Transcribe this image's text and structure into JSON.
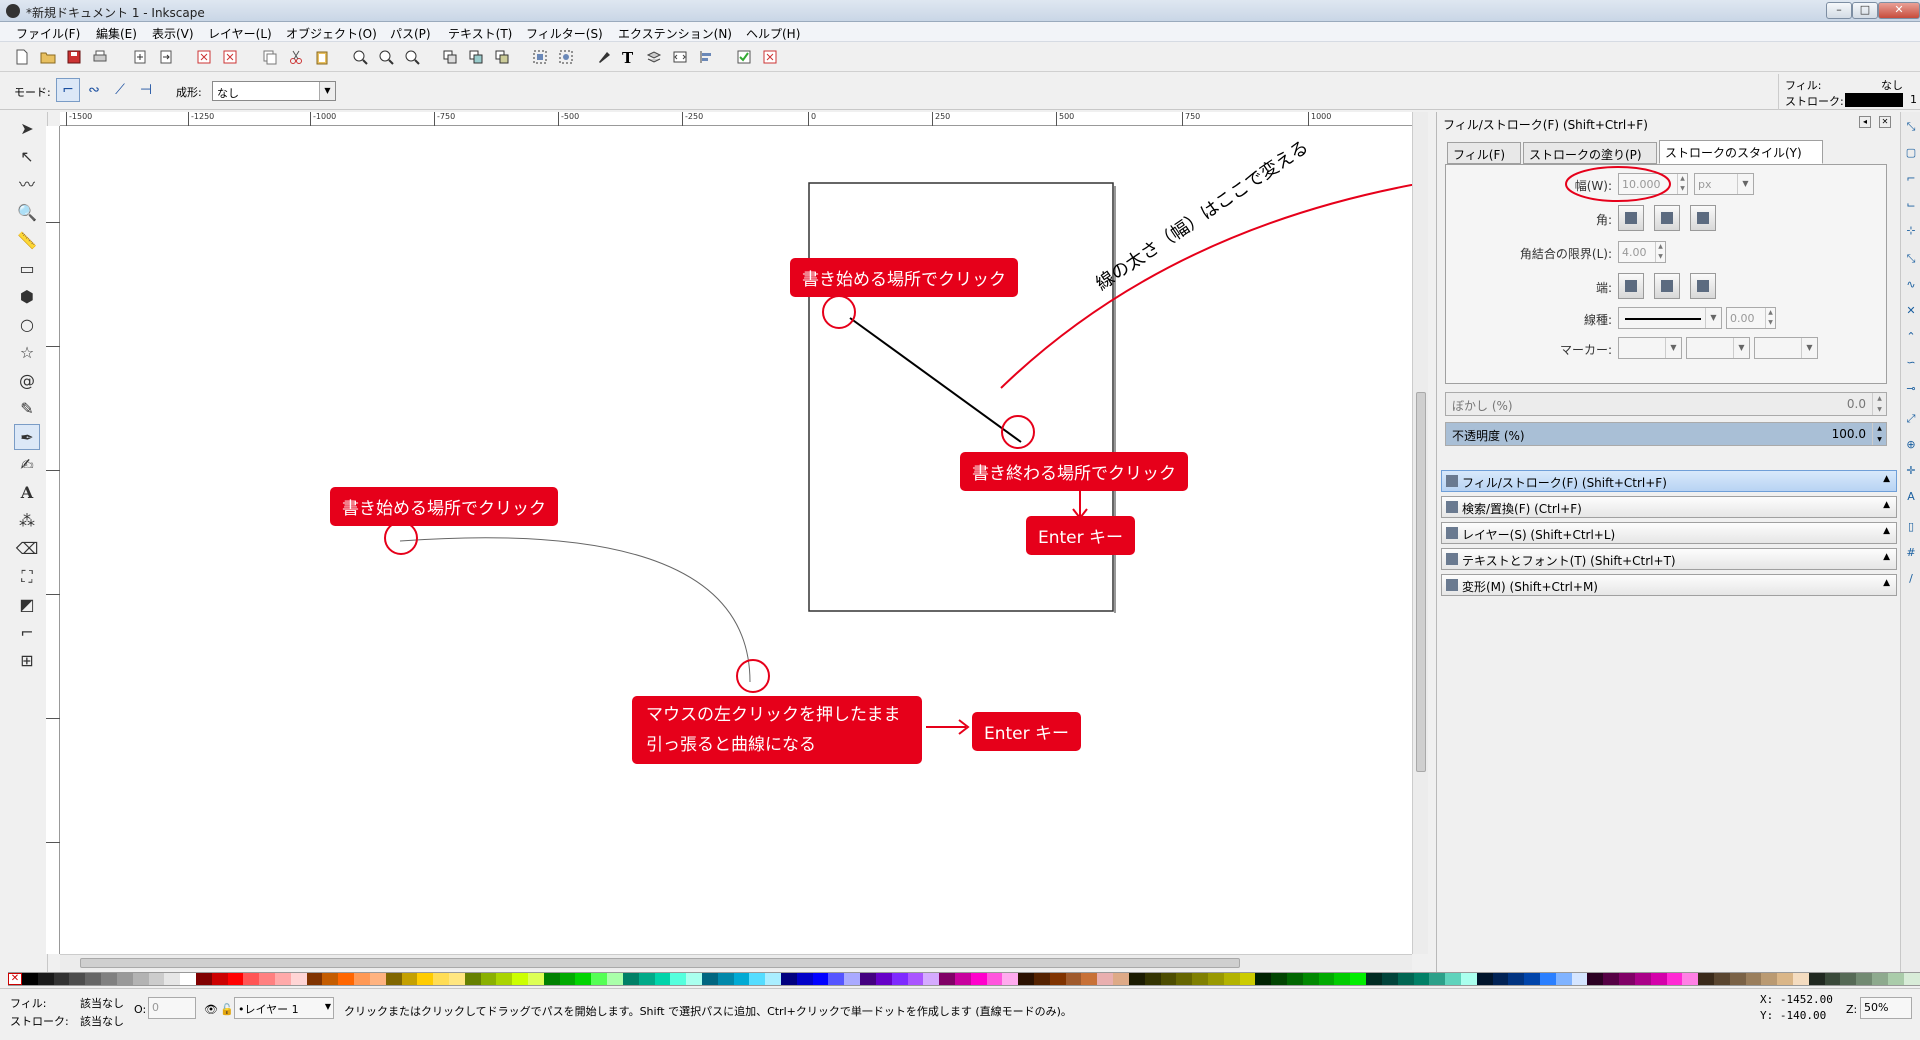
{
  "window": {
    "title": "*新規ドキュメント 1 - Inkscape"
  },
  "menubar": [
    "ファイル(F)",
    "編集(E)",
    "表示(V)",
    "レイヤー(L)",
    "オブジェクト(O)",
    "パス(P)",
    "テキスト(T)",
    "フィルター(S)",
    "エクステンション(N)",
    "ヘルプ(H)"
  ],
  "ctrlbar": {
    "mode_label": "モード:",
    "shape_label": "成形:",
    "shape_value": "なし"
  },
  "style_indicator": {
    "fill_label": "フィル:",
    "fill_value": "なし",
    "stroke_label": "ストローク:",
    "stroke_width": "1"
  },
  "ruler_ticks": [
    "-1500",
    "-1250",
    "-1000",
    "-750",
    "-500",
    "-250",
    "0",
    "250",
    "500",
    "750",
    "1000"
  ],
  "dock": {
    "title": "フィル/ストローク(F) (Shift+Ctrl+F)",
    "tabs": [
      "フィル(F)",
      "ストロークの塗り(P)",
      "ストロークのスタイル(Y)"
    ],
    "width_label": "幅(W):",
    "width_value": "10.000",
    "width_unit": "px",
    "join_label": "角:",
    "miter_label": "角結合の限界(L):",
    "miter_value": "4.00",
    "cap_label": "端:",
    "dash_label": "線種:",
    "dash_value": "0.00",
    "markers_label": "マーカー:",
    "blur_label": "ぼかし (%)",
    "blur_value": "0.0",
    "opacity_label": "不透明度 (%)",
    "opacity_value": "100.0",
    "opacity_fraction": 1.0,
    "panels": [
      "フィル/ストローク(F) (Shift+Ctrl+F)",
      "検索/置換(F) (Ctrl+F)",
      "レイヤー(S) (Shift+Ctrl+L)",
      "テキストとフォント(T) (Shift+Ctrl+T)",
      "変形(M) (Shift+Ctrl+M)"
    ]
  },
  "annotations": {
    "start_click_1": "書き始める場所でクリック",
    "end_click": "書き終わる場所でクリック",
    "enter_1": "Enter キー",
    "start_click_2": "書き始める場所でクリック",
    "drag_line1": "マウスの左クリックを押したまま",
    "drag_line2": "引っ張ると曲線になる",
    "enter_2": "Enter キー",
    "width_note": "線の太さ（幅）はここで変える"
  },
  "statusbar": {
    "fill_label": "フィル:",
    "fill_value": "該当なし",
    "stroke_label": "ストローク:",
    "stroke_value": "該当なし",
    "o_label": "O:",
    "o_value": "0",
    "layer": "•レイヤー 1",
    "message": "クリックまたはクリックしてドラッグでパスを開始します。Shift で選択パスに追加、Ctrl+クリックで単一ドットを作成します (直線モードのみ)。",
    "x_coord": "X: -1452.00",
    "y_coord": "Y: -140.00",
    "zoom_label": "Z:",
    "zoom_value": "50%"
  },
  "colors": {
    "accent_red": "#e6001a",
    "selected_blue": "#dce8f7"
  }
}
